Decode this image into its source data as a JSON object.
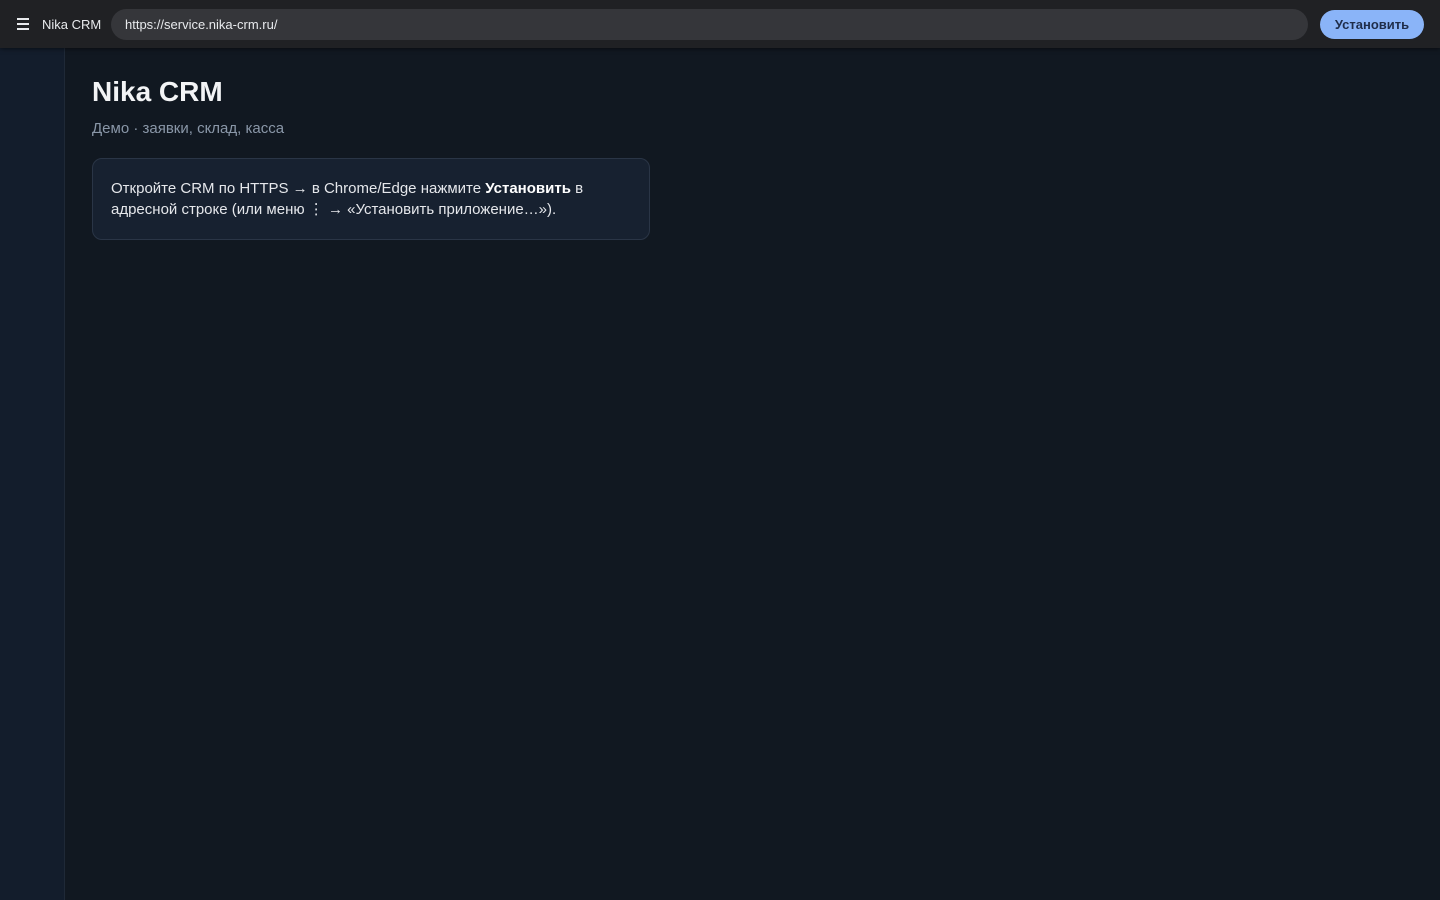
{
  "topbar": {
    "app_title": "Nika CRM",
    "url": "https://service.nika-crm.ru/",
    "install_label": "Установить",
    "menu_icon": "hamburger-menu-icon"
  },
  "main": {
    "title": "Nika CRM",
    "subtitle": "Демо · заявки, склад, касса",
    "card": {
      "text_before": "Откройте CRM по HTTPS → в Chrome/Edge нажмите ",
      "bold": "Установить",
      "text_after": " в адресной строке (или меню ⋮ → «Установить приложение…»)."
    }
  },
  "colors": {
    "accent": "#8ab4f8",
    "background": "#111821",
    "sidebar": "#131d2c",
    "card": "#172130"
  }
}
